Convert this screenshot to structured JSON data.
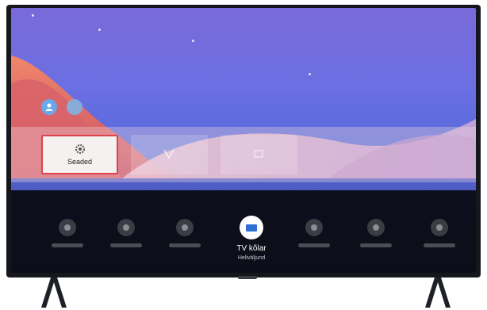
{
  "settings_tile": {
    "label": "Seaded"
  },
  "quick_panel": {
    "focused_item": {
      "label": "TV kõlar",
      "sublabel": "Heliväljund"
    }
  },
  "icons": {
    "settings": "gear-icon",
    "tv_speaker": "tv-speaker-icon",
    "profile": "user-avatar-icon"
  },
  "colors": {
    "focus_border": "#e0414e",
    "panel_background": "#080a0e",
    "accent_blue": "#2f6fd6"
  }
}
